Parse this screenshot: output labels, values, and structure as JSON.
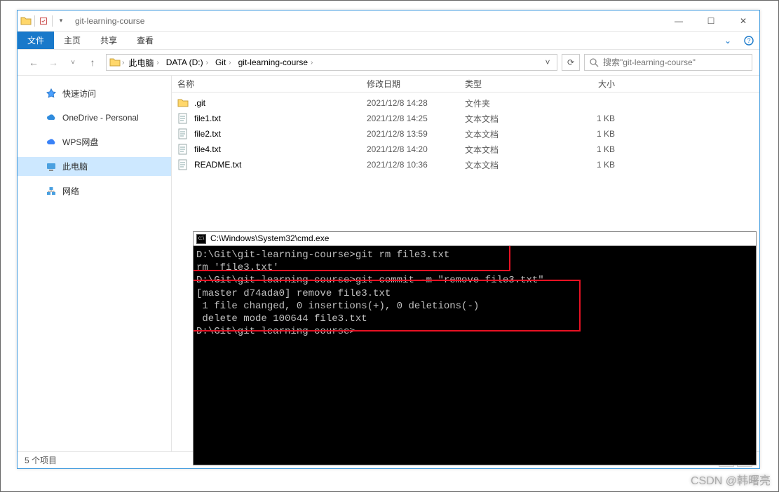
{
  "window": {
    "title": "git-learning-course",
    "controls": {
      "min": "—",
      "max": "☐",
      "close": "✕"
    }
  },
  "ribbon": {
    "file": "文件",
    "tabs": [
      "主页",
      "共享",
      "查看"
    ],
    "expand": "⌄",
    "help": "?"
  },
  "nav": {
    "back": "←",
    "forward": "→",
    "recent": "˅",
    "up": "↑",
    "crumbs": [
      "此电脑",
      "DATA (D:)",
      "Git",
      "git-learning-course"
    ],
    "refresh": "⟳"
  },
  "search": {
    "placeholder": "搜索\"git-learning-course\""
  },
  "sidebar": {
    "items": [
      {
        "label": "快速访问",
        "icon": "star"
      },
      {
        "label": "OneDrive - Personal",
        "icon": "cloud"
      },
      {
        "label": "WPS网盘",
        "icon": "cloud2"
      },
      {
        "label": "此电脑",
        "icon": "pc",
        "selected": true
      },
      {
        "label": "网络",
        "icon": "net"
      }
    ]
  },
  "columns": {
    "name": "名称",
    "date": "修改日期",
    "type": "类型",
    "size": "大小"
  },
  "files": [
    {
      "name": ".git",
      "date": "2021/12/8 14:28",
      "type": "文件夹",
      "size": "",
      "icon": "folder"
    },
    {
      "name": "file1.txt",
      "date": "2021/12/8 14:25",
      "type": "文本文档",
      "size": "1 KB",
      "icon": "txt"
    },
    {
      "name": "file2.txt",
      "date": "2021/12/8 13:59",
      "type": "文本文档",
      "size": "1 KB",
      "icon": "txt"
    },
    {
      "name": "file4.txt",
      "date": "2021/12/8 14:20",
      "type": "文本文档",
      "size": "1 KB",
      "icon": "txt"
    },
    {
      "name": "README.txt",
      "date": "2021/12/8 10:36",
      "type": "文本文档",
      "size": "1 KB",
      "icon": "txt"
    }
  ],
  "status": {
    "count": "5 个项目"
  },
  "cmd": {
    "title": "C:\\Windows\\System32\\cmd.exe",
    "lines": [
      "D:\\Git\\git-learning-course>git rm file3.txt",
      "rm 'file3.txt'",
      "",
      "D:\\Git\\git-learning-course>git commit -m \"remove file3.txt\"",
      "[master d74ada0] remove file3.txt",
      " 1 file changed, 0 insertions(+), 0 deletions(-)",
      " delete mode 100644 file3.txt",
      "",
      "D:\\Git\\git-learning-course>"
    ]
  },
  "watermark": "CSDN @韩曙亮"
}
